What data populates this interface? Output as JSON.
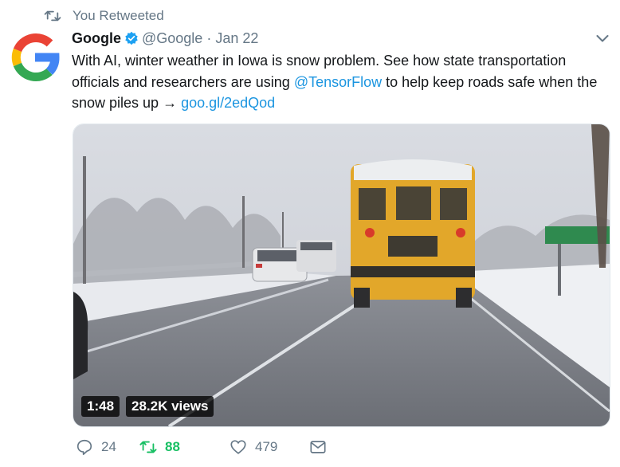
{
  "retweet_banner": {
    "text": "You Retweeted",
    "icon": "retweet-icon"
  },
  "tweet": {
    "author": {
      "name": "Google",
      "handle": "@Google",
      "verified": true,
      "avatar_icon": "google-g-logo"
    },
    "separator": "·",
    "date": "Jan 22",
    "text": {
      "part1": "With AI, winter weather in Iowa is snow problem. See how state transportation officials and researchers are using ",
      "mention": "@TensorFlow",
      "part2": " to help keep roads safe when the snow piles up → ",
      "link": "goo.gl/2edQod"
    },
    "video": {
      "duration": "1:48",
      "views": "28.2K views"
    },
    "actions": {
      "reply_count": "24",
      "retweet_count": "88",
      "like_count": "479"
    }
  },
  "colors": {
    "link": "#1b95e0",
    "retweet_active": "#17bf63",
    "muted": "#657786",
    "verified": "#1da1f2"
  }
}
